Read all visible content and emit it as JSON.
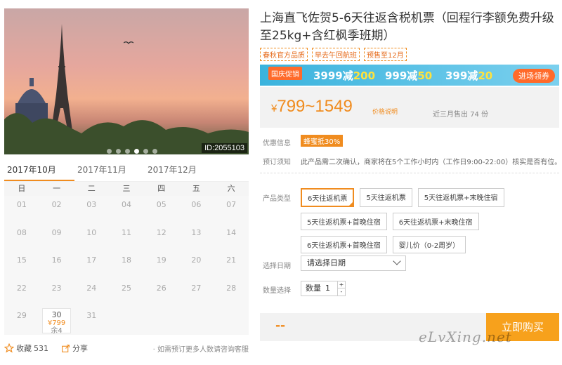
{
  "gallery": {
    "image_id": "ID:2055103"
  },
  "calendar": {
    "months": [
      "2017年10月",
      "2017年11月",
      "2017年12月"
    ],
    "weekdays": [
      "日",
      "一",
      "二",
      "三",
      "四",
      "五",
      "六"
    ],
    "days": [
      "01",
      "02",
      "03",
      "04",
      "05",
      "06",
      "07",
      "08",
      "09",
      "10",
      "11",
      "12",
      "13",
      "14",
      "15",
      "16",
      "17",
      "18",
      "19",
      "20",
      "21",
      "22",
      "23",
      "24",
      "25",
      "26",
      "27",
      "28",
      "29",
      "30",
      "31"
    ],
    "available_day": {
      "price": "¥799",
      "remain": "余4"
    }
  },
  "footer": {
    "favorite_label": "收藏",
    "favorite_count": "531",
    "share_label": "分享",
    "contact_text": "· 如需预订更多人数请咨询客服"
  },
  "product": {
    "title": "上海直飞佐贺5-6天往返含税机票（回程行李额免费升级至25kg+含红枫季班期）",
    "tags": [
      "春秋官方品质",
      "早去午回航班",
      "预售至12月"
    ],
    "promo": {
      "badge": "国庆促销",
      "deal1_a": "3999减",
      "deal1_b": "200",
      "deal2_a": "999减",
      "deal2_b": "50",
      "deal3_a": "399减",
      "deal3_b": "20",
      "cta": "进场领券"
    },
    "price": {
      "currency": "¥",
      "range": "799~1549",
      "explain": "价格说明",
      "sold": "近三月售出 74 份"
    },
    "discount": {
      "label": "优惠信息",
      "badge": "蜂蜜抵30%"
    },
    "notice": {
      "label": "预订须知",
      "text": "此产品需二次确认，商家将在5个工作小时内（工作日9:00-22:00）核实是否有位。"
    },
    "type_label": "产品类型",
    "options": [
      "6天往返机票",
      "5天往返机票",
      "5天往返机票+末晚住宿",
      "5天往返机票+首晚住宿",
      "6天往返机票+末晚住宿",
      "6天往返机票+首晚住宿",
      "婴儿价（0-2周岁）"
    ],
    "date_label": "选择日期",
    "date_placeholder": "请选择日期",
    "qty_label": "数量选择",
    "qty_text": "数量",
    "qty_value": "1",
    "total": "--",
    "buy_label": "立即购买"
  },
  "watermark": "eLvXing.net",
  "colors": {
    "accent": "#f08c1f",
    "promo_bg": "#3ab3dd",
    "buy": "#f7a11c"
  }
}
